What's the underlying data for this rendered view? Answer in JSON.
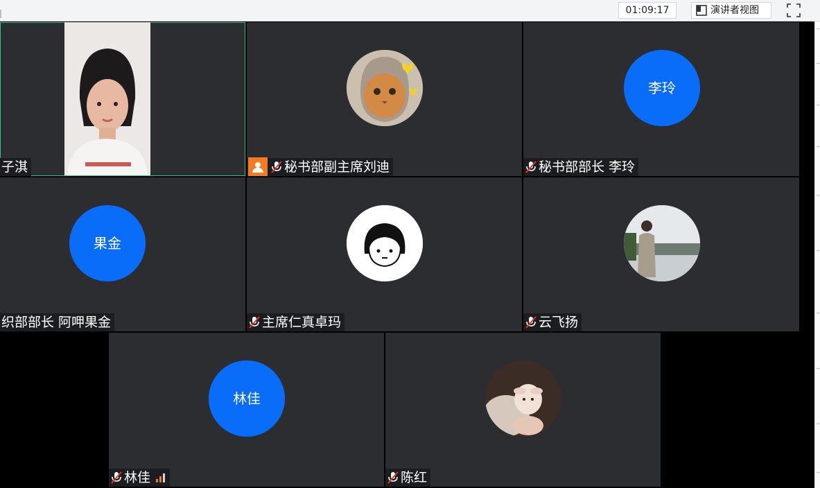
{
  "toolbar": {
    "timer": "01:09:17",
    "speaker_view_label": "演讲者视图"
  },
  "participants": [
    {
      "name": "子淇",
      "avatar_text": "",
      "muted": false
    },
    {
      "name": "秘书部副主席刘迪",
      "avatar_text": "",
      "muted": true,
      "host": true
    },
    {
      "name": "秘书部部长 李玲",
      "avatar_text": "李玲",
      "muted": true
    },
    {
      "name": "织部部长 阿呷果金",
      "avatar_text": "果金",
      "muted": false
    },
    {
      "name": "主席仁真卓玛",
      "avatar_text": "",
      "muted": true
    },
    {
      "name": "云飞扬",
      "avatar_text": "",
      "muted": true
    },
    {
      "name": "林佳",
      "avatar_text": "林佳",
      "muted": true
    },
    {
      "name": "陈红",
      "avatar_text": "",
      "muted": true
    }
  ],
  "colors": {
    "tile_bg": "#2b2d31",
    "avatar_blue": "#0a6dfa",
    "host_orange": "#f47b20",
    "active_border": "#3fbf7f"
  }
}
